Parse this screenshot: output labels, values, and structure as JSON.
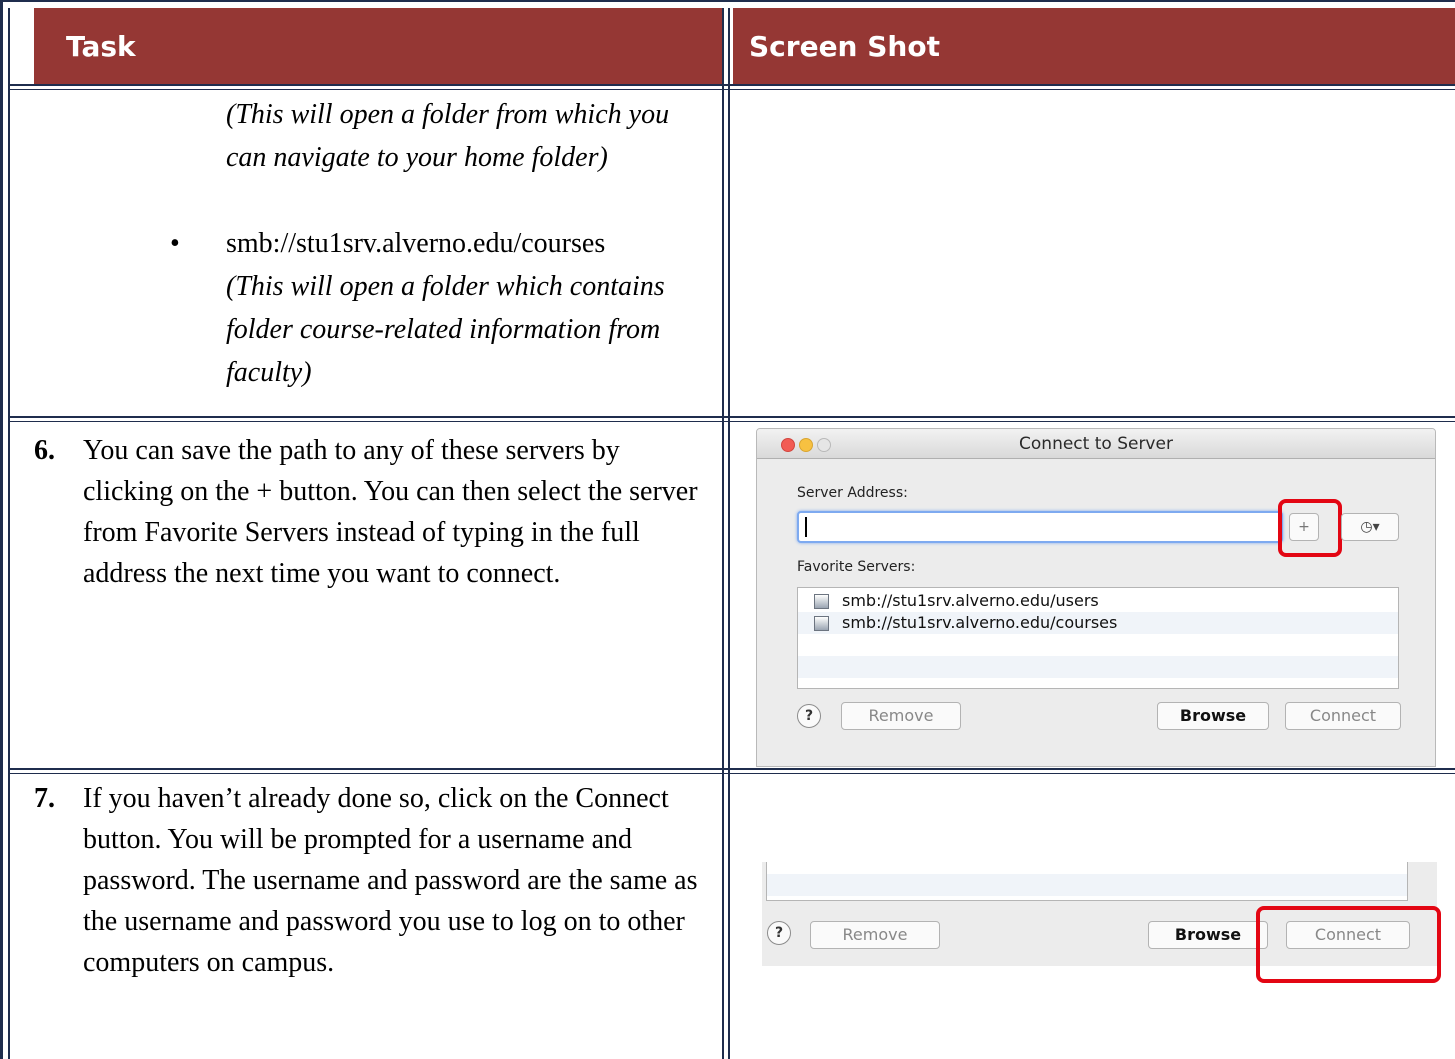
{
  "table": {
    "col_task": "Task",
    "col_screenshot": "Screen Shot"
  },
  "continuation": {
    "home_note": "(This will open a folder from which you can navigate to your home folder)",
    "bullet_symbol": "•",
    "courses_path": "smb://stu1srv.alverno.edu/courses",
    "courses_note": "(This will open a folder which contains folder course-related information from faculty)"
  },
  "steps": [
    {
      "number": "6.",
      "text": "You can save the path to any of these servers by clicking on the + button. You can then select the server from Favorite Servers instead of typing in the full address the next time you want to connect."
    },
    {
      "number": "7.",
      "text": "If you haven’t already done so, click on the Connect button. You will be prompted for a username and password. The username and password are the same as the username and password you use to log on to other computers on campus."
    }
  ],
  "dialog": {
    "title": "Connect to Server",
    "server_address_label": "Server Address:",
    "server_address_value": "",
    "add_button": "+",
    "recent_button": "◷▾",
    "favorite_label": "Favorite Servers:",
    "favorites": [
      "smb://stu1srv.alverno.edu/users",
      "smb://stu1srv.alverno.edu/courses"
    ],
    "help": "?",
    "remove": "Remove",
    "browse": "Browse",
    "connect": "Connect"
  },
  "crop_dialog": {
    "help": "?",
    "remove": "Remove",
    "browse": "Browse",
    "connect": "Connect"
  },
  "colors": {
    "header_bg": "#953734",
    "border": "#1f2d4d",
    "highlight": "#e30613"
  }
}
